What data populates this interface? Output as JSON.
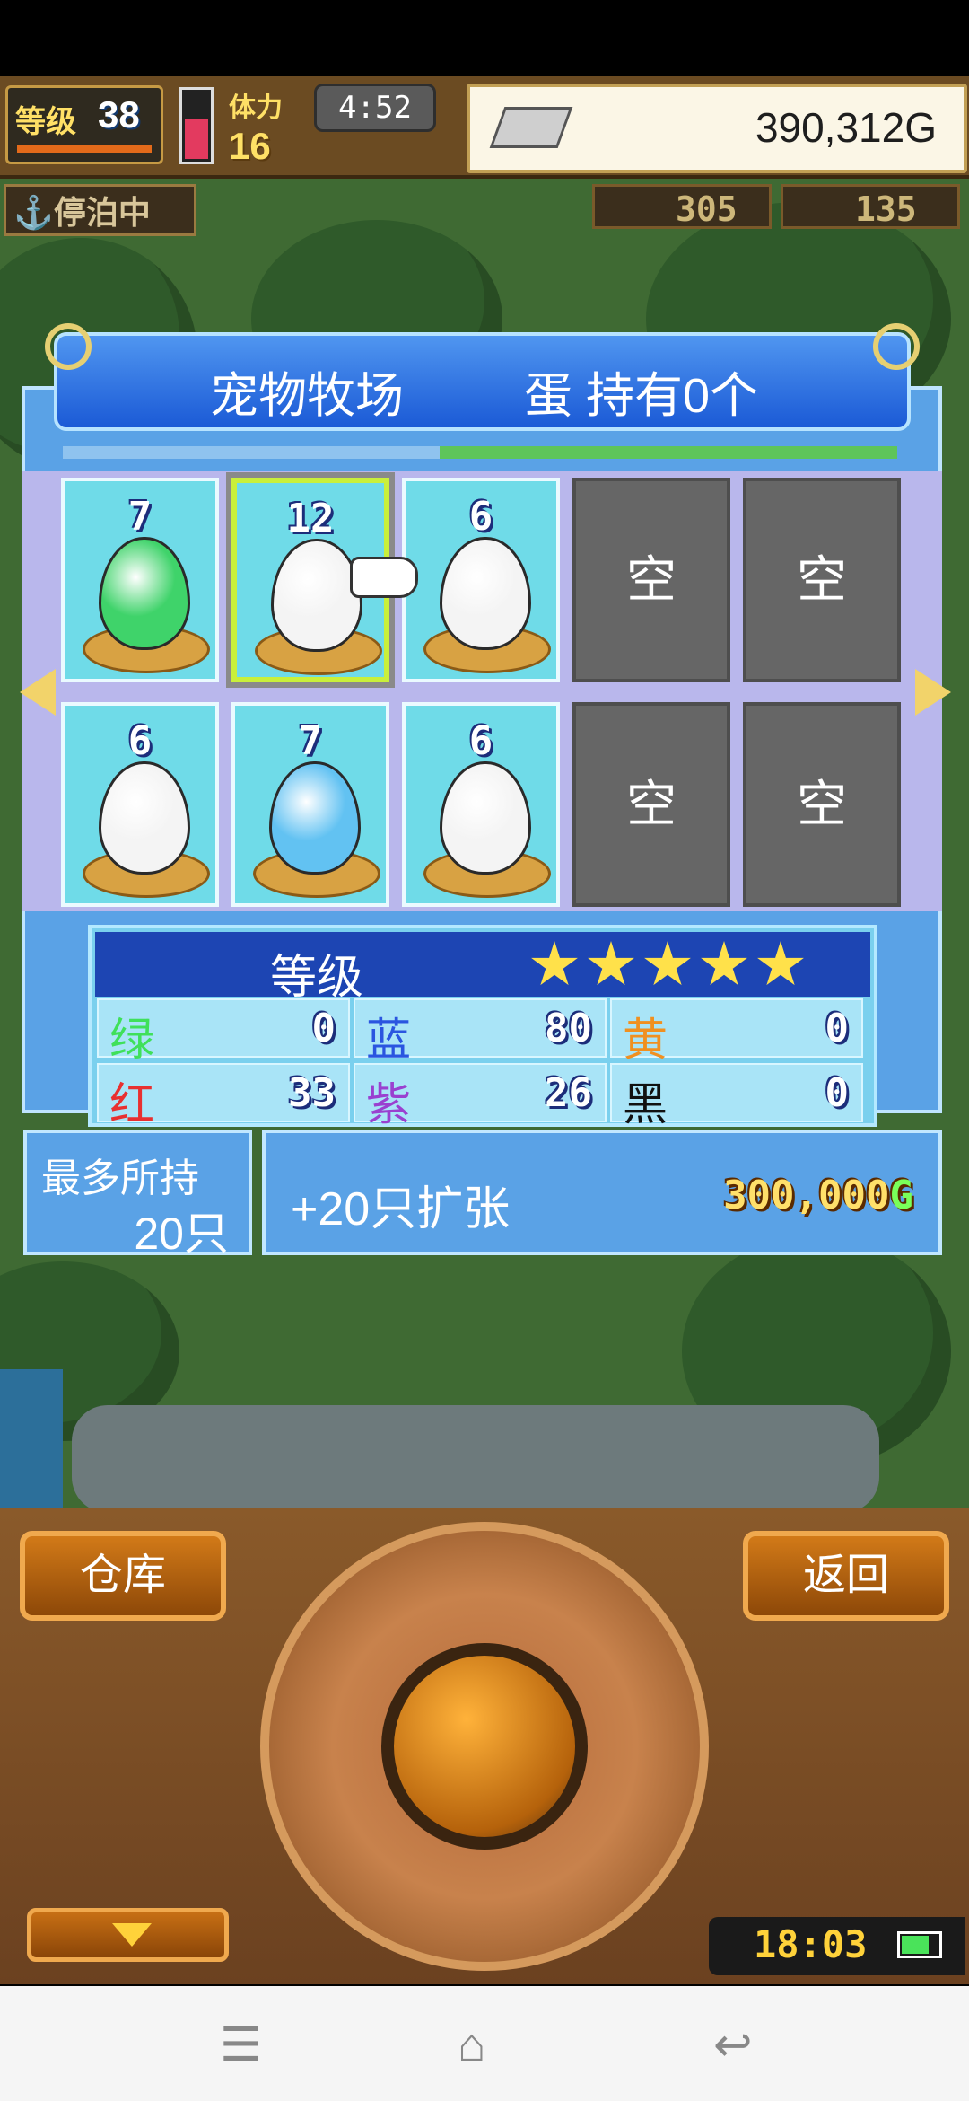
{
  "hud": {
    "level_label": "等级",
    "level_value": "38",
    "stamina_label": "体力",
    "stamina_value": "16",
    "game_clock": "4:52",
    "money": "390,312G",
    "status": "停泊中",
    "resource_a": "305",
    "resource_b": "135"
  },
  "panel": {
    "title": "宠物牧场",
    "egg_count": "蛋 持有0个",
    "slots": [
      {
        "number": "7",
        "kind": "egg",
        "color": "#3fd36a"
      },
      {
        "number": "12",
        "kind": "egg",
        "color": "#f4f4f4",
        "selected": true
      },
      {
        "number": "6",
        "kind": "egg",
        "color": "#f4f4f4"
      },
      {
        "label": "空",
        "kind": "empty"
      },
      {
        "label": "空",
        "kind": "empty"
      },
      {
        "number": "6",
        "kind": "egg",
        "color": "#f4f4f4"
      },
      {
        "number": "7",
        "kind": "egg",
        "color": "#62c2f2"
      },
      {
        "number": "6",
        "kind": "egg",
        "color": "#f4f4f4"
      },
      {
        "label": "空",
        "kind": "empty"
      },
      {
        "label": "空",
        "kind": "empty"
      }
    ]
  },
  "stats": {
    "header": "等级",
    "stars": 5,
    "rows": [
      [
        {
          "k": "绿",
          "v": "0",
          "color": "#3fe05a"
        },
        {
          "k": "蓝",
          "v": "80",
          "color": "#2a55e0"
        },
        {
          "k": "黄",
          "v": "0",
          "color": "#f09020"
        }
      ],
      [
        {
          "k": "红",
          "v": "33",
          "color": "#e83030"
        },
        {
          "k": "紫",
          "v": "26",
          "color": "#9a40d0"
        },
        {
          "k": "黑",
          "v": "0",
          "color": "#111111"
        }
      ]
    ]
  },
  "max_hold": {
    "label": "最多所持",
    "value": "20只"
  },
  "expand": {
    "label": "+20只扩张",
    "price": "300,000",
    "currency": "G"
  },
  "controls": {
    "warehouse": "仓库",
    "back": "返回"
  },
  "device_clock": "18:03",
  "colors": {
    "accent_blue": "#1d45b3",
    "panel_blue": "#5aa2e6",
    "wood": "#8a5a2a"
  }
}
